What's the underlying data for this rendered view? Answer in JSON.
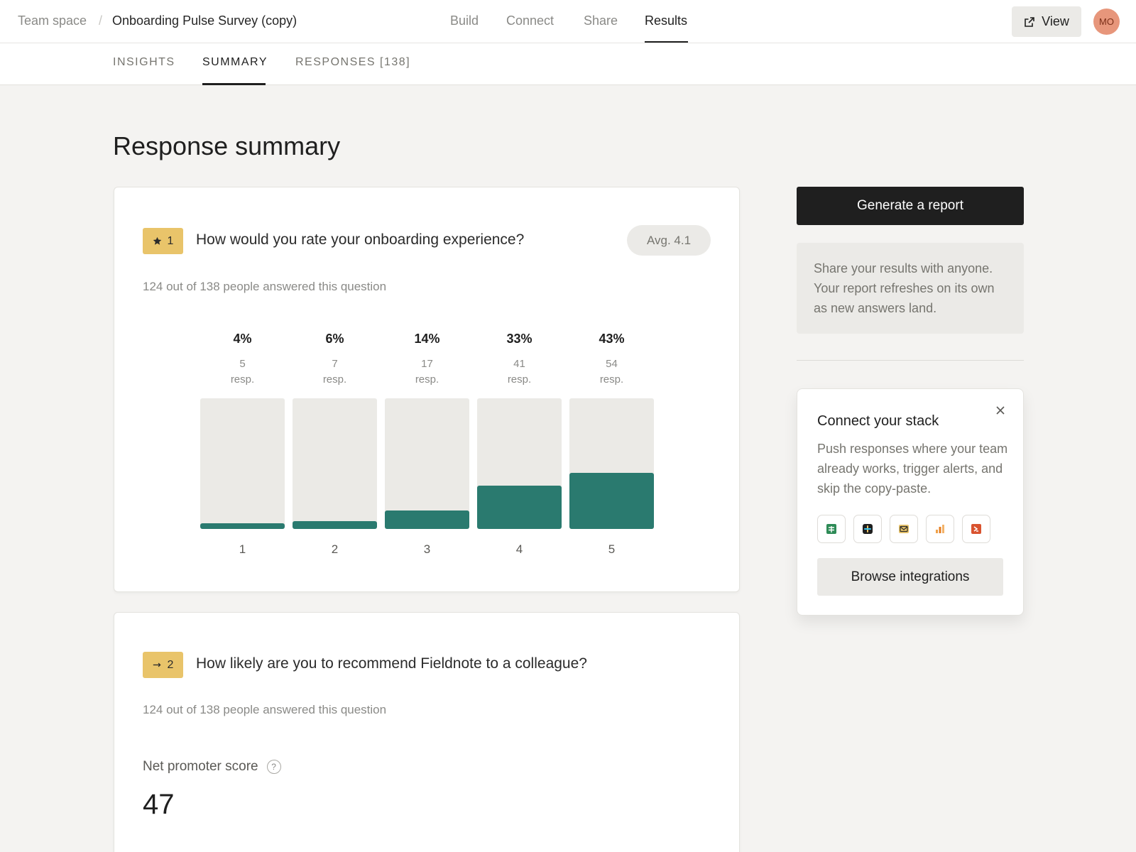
{
  "header": {
    "breadcrumb_space": "Team space",
    "breadcrumb_sep": "/",
    "survey_title": "Onboarding Pulse Survey (copy)",
    "nav": [
      {
        "label": "Build"
      },
      {
        "label": "Connect"
      },
      {
        "label": "Share"
      },
      {
        "label": "Results",
        "active": true
      }
    ],
    "view_label": "View",
    "avatar_initials": "MO"
  },
  "subtabs": [
    {
      "label": "INSIGHTS"
    },
    {
      "label": "SUMMARY",
      "active": true
    },
    {
      "label": "RESPONSES [138]"
    }
  ],
  "page_title": "Response summary",
  "question1": {
    "number": "1",
    "icon": "star-icon",
    "title": "How would you rate your onboarding experience?",
    "avg": "Avg. 4.1",
    "answered": "124 out of 138 people answered this question"
  },
  "chart_data": {
    "type": "bar",
    "categories": [
      "1",
      "2",
      "3",
      "4",
      "5"
    ],
    "values": [
      4,
      6,
      14,
      33,
      43
    ],
    "value_labels": [
      "4%",
      "6%",
      "14%",
      "33%",
      "43%"
    ],
    "counts": [
      "5",
      "7",
      "17",
      "41",
      "54"
    ],
    "count_unit": "resp.",
    "ylim": [
      0,
      100
    ],
    "bar_color": "#2a7a6f",
    "track_color": "#ebeae6"
  },
  "question2": {
    "number": "2",
    "icon": "arrow-right-icon",
    "title": "How likely are you to recommend Fieldnote to a colleague?",
    "answered": "124 out of 138 people answered this question",
    "nps_label": "Net promoter score",
    "nps_help": "?",
    "nps_value": "47"
  },
  "sidebar": {
    "generate_label": "Generate a report",
    "share_text": "Share your results with anyone. Your report refreshes on its own as new answers land.",
    "connect": {
      "title": "Connect your stack",
      "description": "Push responses where your team already works, trigger alerts, and skip the copy-paste.",
      "integrations": [
        "sheets-icon",
        "slack-icon",
        "email-icon",
        "analytics-icon",
        "zapier-icon"
      ],
      "browse_label": "Browse integrations"
    }
  },
  "colors": {
    "accent": "#2a7a6f",
    "badge": "#e9c46a",
    "avatar": "#e7967b",
    "primary_button": "#1f1f1f"
  }
}
